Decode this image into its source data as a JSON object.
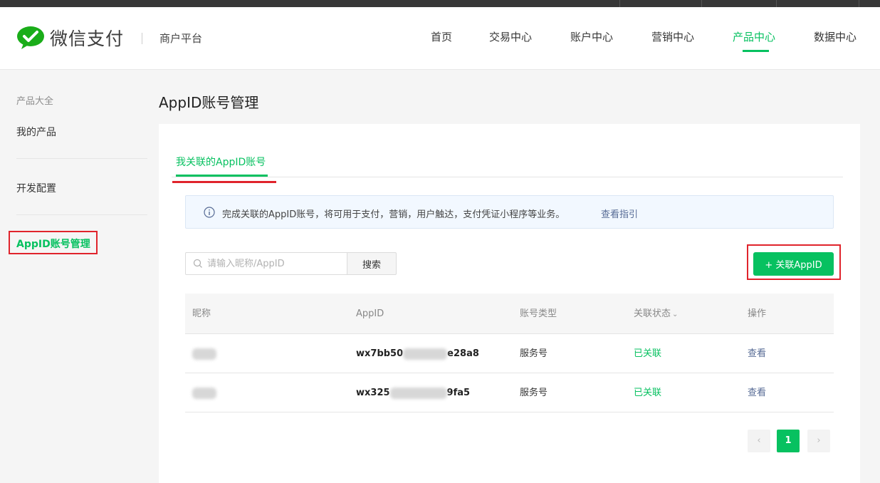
{
  "header": {
    "logo_text": "微信支付",
    "platform": "商户平台",
    "nav": [
      {
        "label": "首页"
      },
      {
        "label": "交易中心"
      },
      {
        "label": "账户中心"
      },
      {
        "label": "营销中心"
      },
      {
        "label": "产品中心",
        "active": true
      },
      {
        "label": "数据中心"
      }
    ]
  },
  "sidebar": {
    "group_label": "产品大全",
    "items": [
      {
        "label": "我的产品"
      },
      {
        "label": "开发配置"
      },
      {
        "label": "AppID账号管理",
        "active": true
      }
    ]
  },
  "page": {
    "title": "AppID账号管理",
    "tab": "我关联的AppID账号",
    "notice": {
      "text": "完成关联的AppID账号，将可用于支付，营销，用户触达，支付凭证小程序等业务。",
      "link": "查看指引"
    },
    "search": {
      "placeholder": "请输入昵称/AppID",
      "button": "搜索"
    },
    "add_button": "+ 关联AppID",
    "table": {
      "columns": [
        "昵称",
        "AppID",
        "账号类型",
        "关联状态",
        "操作"
      ],
      "rows": [
        {
          "nickname": "",
          "appid_prefix": "wx7bb50",
          "appid_suffix": "e28a8",
          "type": "服务号",
          "status": "已关联",
          "action": "查看"
        },
        {
          "nickname": "",
          "appid_prefix": "wx325",
          "appid_suffix": "9fa5",
          "type": "服务号",
          "status": "已关联",
          "action": "查看"
        }
      ]
    },
    "pagination": {
      "current": "1"
    }
  },
  "colors": {
    "accent": "#07c160",
    "link": "#576b95",
    "highlight": "#e0242c"
  }
}
